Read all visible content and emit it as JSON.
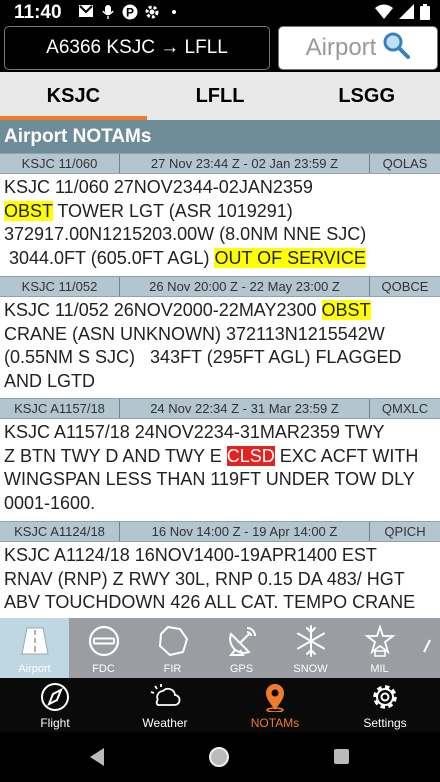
{
  "status_bar": {
    "time": "11:40"
  },
  "header": {
    "route_label": "A6366 KSJC → LFLL",
    "airport_button_label": "Airport"
  },
  "tabs": [
    {
      "label": "KSJC",
      "active": true
    },
    {
      "label": "LFLL",
      "active": false
    },
    {
      "label": "LSGG",
      "active": false
    }
  ],
  "section_title": "Airport NOTAMs",
  "notams": [
    {
      "id": "KSJC 11/060",
      "validity": "27 Nov 23:44 Z - 02 Jan 23:59 Z",
      "code": "QOLAS",
      "line1": "KSJC 11/060 27NOV2344-02JAN2359",
      "hl1": "OBST",
      "line2_rest": " TOWER LGT (ASR 1019291)",
      "line3": "372917.00N1215203.00W (8.0NM NNE SJC)",
      "line4_pre": " 3044.0FT (605.0FT AGL) ",
      "hl2": "OUT OF SERVICE"
    },
    {
      "id": "KSJC 11/052",
      "validity": "26 Nov 20:00 Z - 22 May 23:00 Z",
      "code": "QOBCE",
      "line1_pre": "KSJC 11/052 26NOV2000-22MAY2300 ",
      "hl1": "OBST",
      "line2": "CRANE (ASN UNKNOWN) 372113N1215542W",
      "line3": "(0.55NM S SJC)   343FT (295FT AGL) FLAGGED",
      "line4": "AND LGTD"
    },
    {
      "id": "KSJC A1157/18",
      "validity": "24 Nov 22:34 Z - 31 Mar 23:59 Z",
      "code": "QMXLC",
      "line1": "KSJC A1157/18 24NOV2234-31MAR2359 TWY",
      "line2_pre": "Z BTN TWY D AND TWY E ",
      "hl1": "CLSD",
      "line2_post": " EXC ACFT WITH",
      "line3": "WINGSPAN LESS THAN 119FT UNDER TOW DLY",
      "line4": "0001-1600."
    },
    {
      "id": "KSJC A1124/18",
      "validity": "16 Nov 14:00 Z - 19 Apr 14:00 Z",
      "code": "QPICH",
      "line1": "KSJC A1124/18 16NOV1400-19APR1400 EST",
      "line2": "RNAV (RNP) Z RWY 30L, RNP 0.15 DA 483/ HGT",
      "line3": "ABV TOUCHDOWN 426 ALL CAT. TEMPO CRANE"
    }
  ],
  "toolbar": [
    {
      "label": "Airport",
      "icon": "airport-runway-icon",
      "active": true
    },
    {
      "label": "FDC",
      "icon": "no-entry-icon",
      "active": false
    },
    {
      "label": "FIR",
      "icon": "fir-region-icon",
      "active": false
    },
    {
      "label": "GPS",
      "icon": "satellite-dish-icon",
      "active": false
    },
    {
      "label": "SNOW",
      "icon": "snowflake-icon",
      "active": false
    },
    {
      "label": "MIL",
      "icon": "military-star-icon",
      "active": false
    }
  ],
  "bottom_nav": [
    {
      "label": "Flight",
      "icon": "compass-icon",
      "active": false
    },
    {
      "label": "Weather",
      "icon": "weather-cloud-sun-icon",
      "active": false
    },
    {
      "label": "NOTAMs",
      "icon": "map-pin-icon",
      "active": true
    },
    {
      "label": "Settings",
      "icon": "gear-icon",
      "active": false
    }
  ],
  "colors": {
    "accent": "#f07b2a",
    "section_bg": "#6e8d99",
    "notam_header_bg": "#b3c5cf",
    "highlight_yellow": "#ffff00",
    "highlight_red": "#e52222",
    "toolbar_bg": "#9a9ea2",
    "toolbar_active_bg": "#bfd7e2"
  }
}
